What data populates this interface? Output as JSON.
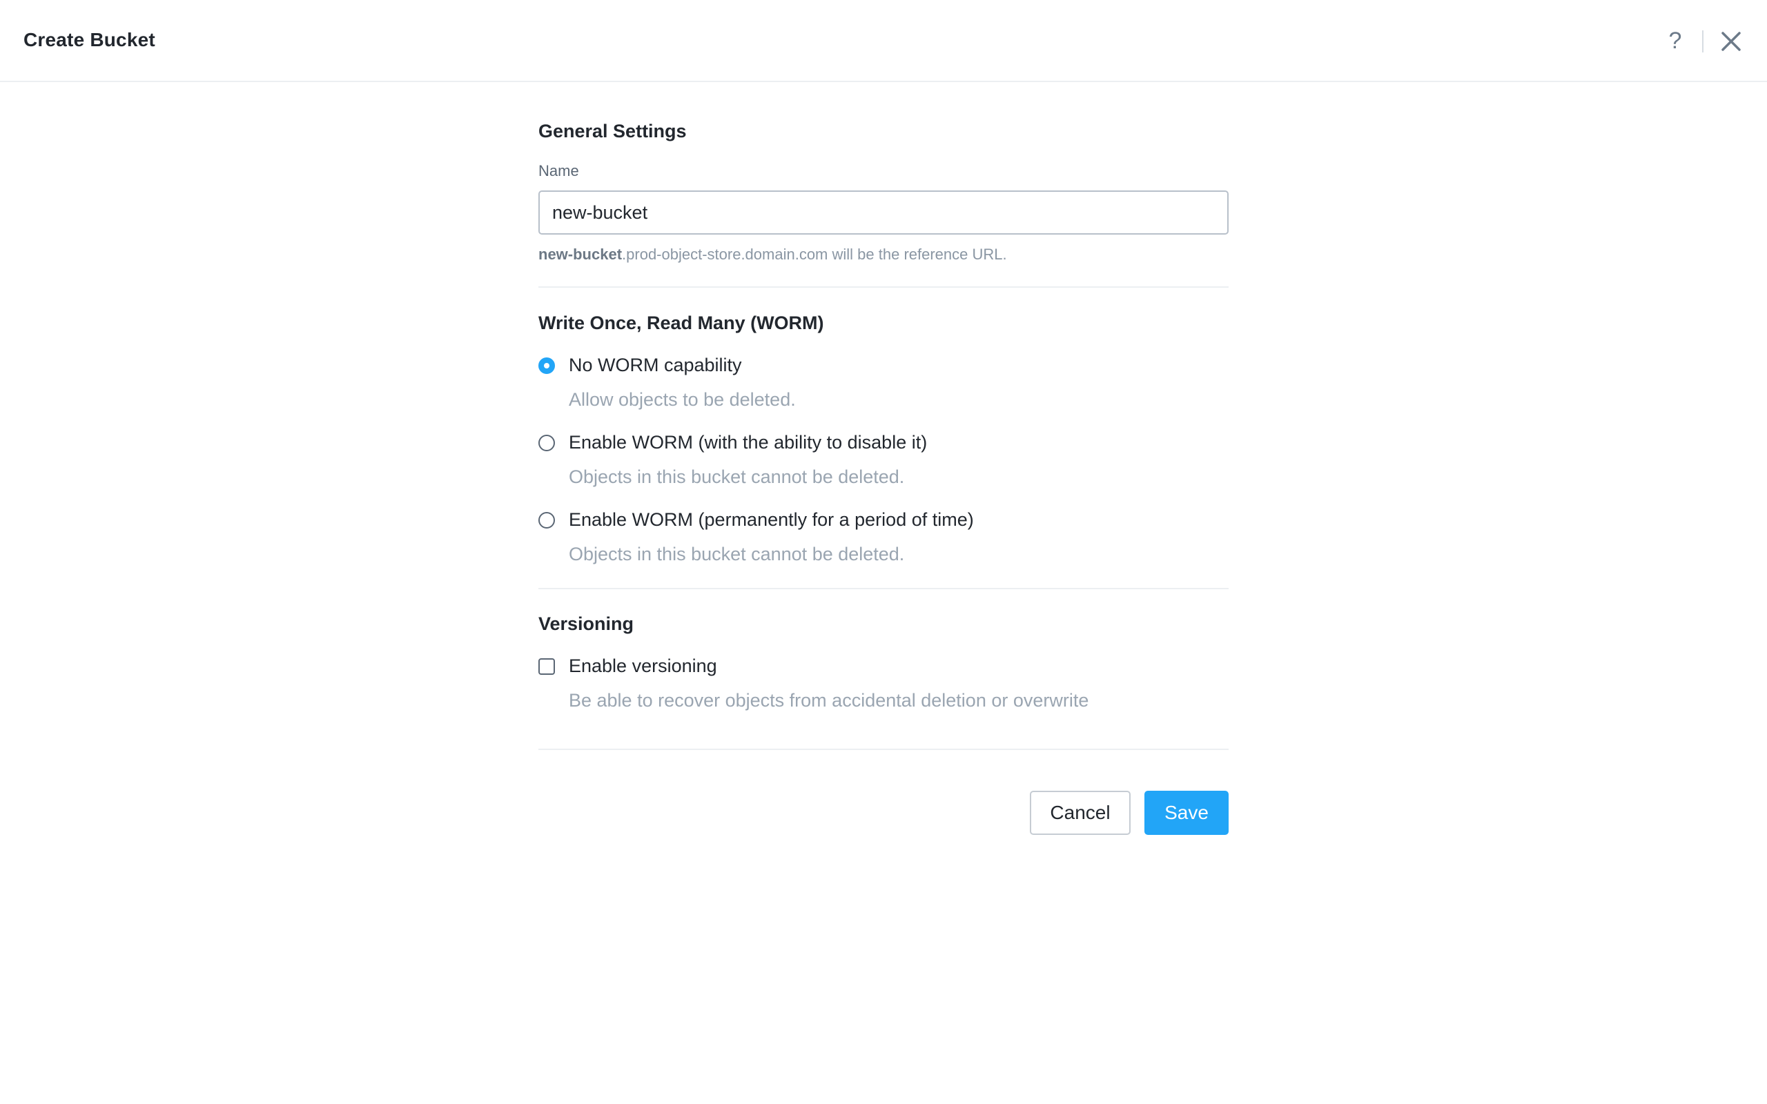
{
  "header": {
    "title": "Create Bucket",
    "help_glyph": "?",
    "icons": {
      "help": "help-icon",
      "close": "close-icon"
    }
  },
  "general": {
    "title": "General Settings",
    "name_label": "Name",
    "name_value": "new-bucket",
    "reference_bucket": "new-bucket",
    "reference_rest": ".prod-object-store.domain.com will be the reference URL."
  },
  "worm": {
    "title": "Write Once, Read Many (WORM)",
    "selected": 0,
    "options": [
      {
        "label": "No WORM capability",
        "description": "Allow objects to be deleted."
      },
      {
        "label": "Enable WORM (with the ability to disable it)",
        "description": "Objects in this bucket cannot be deleted."
      },
      {
        "label": "Enable WORM (permanently for a period of time)",
        "description": "Objects in this bucket cannot be deleted."
      }
    ]
  },
  "versioning": {
    "title": "Versioning",
    "checked": false,
    "label": "Enable versioning",
    "description": "Be able to recover objects from accidental deletion or overwrite"
  },
  "footer": {
    "cancel_label": "Cancel",
    "save_label": "Save"
  },
  "colors": {
    "accent": "#22a5f7",
    "text": "#22272e",
    "muted": "#9aa5b1"
  }
}
